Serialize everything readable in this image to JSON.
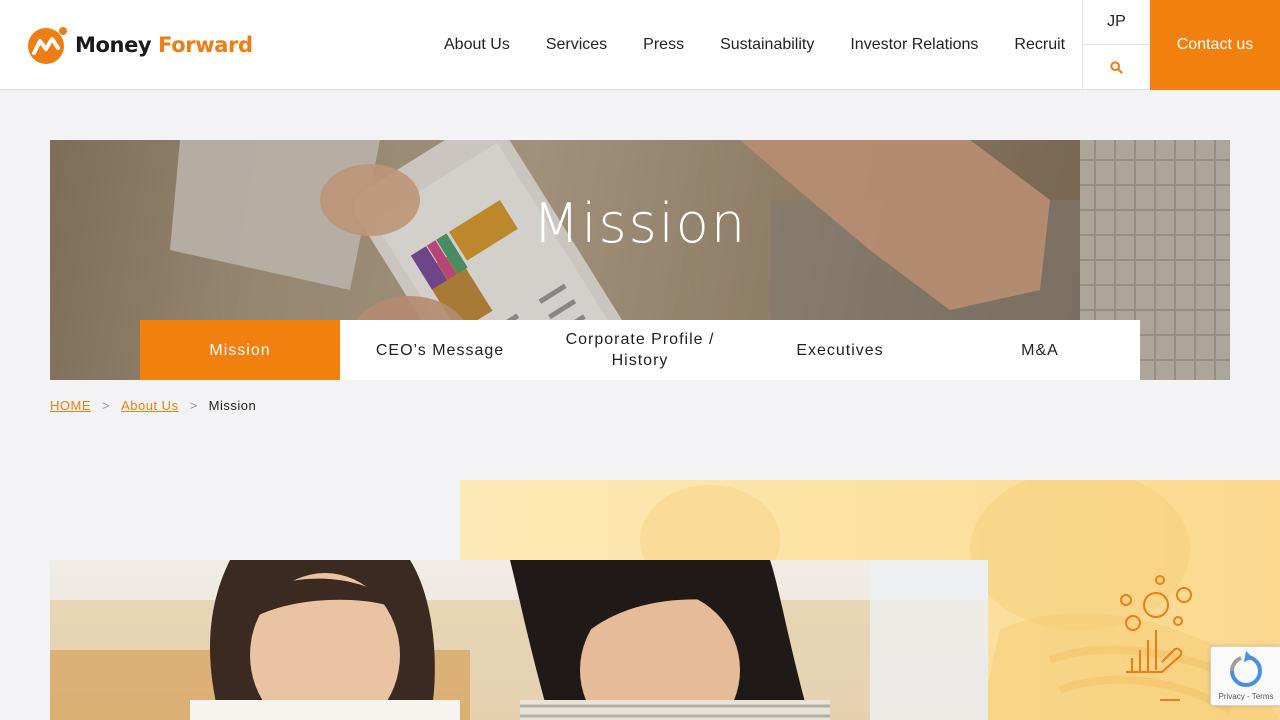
{
  "brand": {
    "name_part1": "Money",
    "name_part2": "Forward",
    "colors": {
      "accent": "#f2800f",
      "text": "#222222",
      "background": "#f3f3f5"
    }
  },
  "header": {
    "nav": [
      "About Us",
      "Services",
      "Press",
      "Sustainability",
      "Investor Relations",
      "Recruit"
    ],
    "lang_label": "JP",
    "search_icon": "search-icon",
    "contact_label": "Contact us"
  },
  "hero": {
    "title": "Mission"
  },
  "subnav": {
    "active_index": 0,
    "items": [
      "Mission",
      "CEO’s Message",
      "Corporate Profile / History",
      "Executives",
      "M&A"
    ]
  },
  "breadcrumb": {
    "home": "HOME",
    "parent": "About Us",
    "separator": ">",
    "current": "Mission"
  },
  "recaptcha": {
    "terms": "Privacy - Terms"
  }
}
